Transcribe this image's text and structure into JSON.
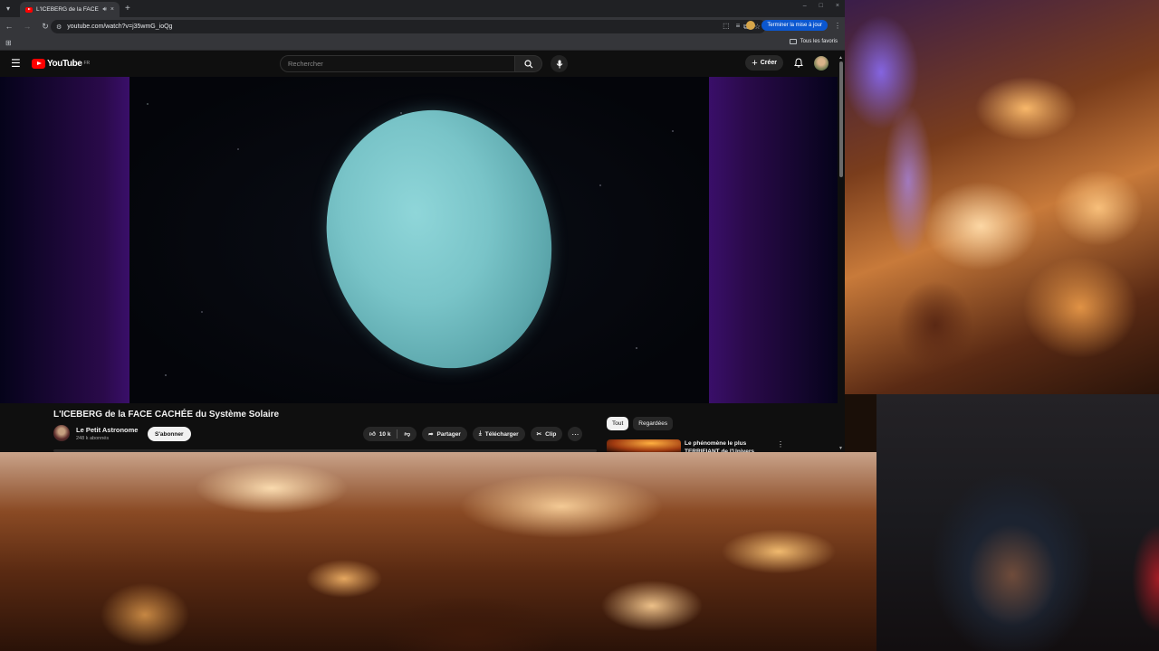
{
  "browser": {
    "tab": {
      "title": "L'ICEBERG de la FACE CACHÉE",
      "audio_icon": "speaker-icon",
      "close": "×"
    },
    "new_tab": "+",
    "window_controls": [
      "–",
      "□",
      "×"
    ],
    "address": "youtube.com/watch?v=j35wmG_ioQg",
    "update_button": "Terminer la mise à jour",
    "bookmarks_label": "Tous les favoris"
  },
  "youtube": {
    "logo_text": "YouTube",
    "country_code": "FR",
    "search_placeholder": "Rechercher",
    "create_label": "Créer",
    "video": {
      "title": "L'ICEBERG de la FACE CACHÉE du Système Solaire",
      "channel": "Le Petit Astronome",
      "subscribers": "248 k abonnés",
      "subscribe_label": "S'abonner",
      "likes": "10 k",
      "share_label": "Partager",
      "download_label": "Télécharger",
      "clip_label": "Clip"
    },
    "chips": [
      "Tout",
      "Regardées"
    ],
    "recommendation": {
      "title": "Le phénomène le plus TERRIFIANT de l'Univers"
    }
  },
  "colors": {
    "youtube_red": "#ff0000",
    "update_blue": "#0b57d0",
    "planet": "#79c4c8"
  }
}
